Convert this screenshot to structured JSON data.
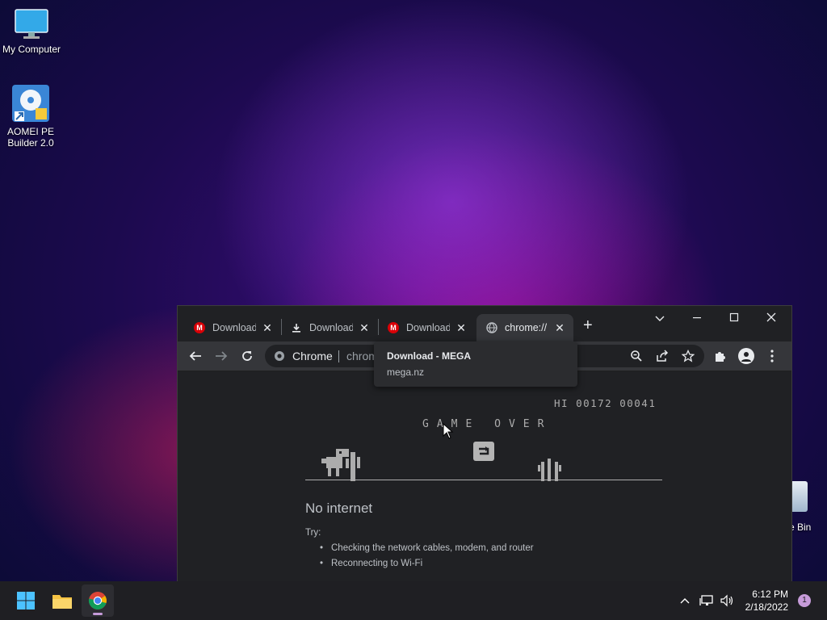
{
  "desktop": {
    "icons": [
      {
        "label": "My Computer",
        "icon": "monitor-icon"
      },
      {
        "label": "AOMEI PE\nBuilder 2.0",
        "icon": "aomei-disc-icon"
      },
      {
        "label": "e Bin",
        "icon": "recycle-bin-icon"
      }
    ]
  },
  "browser": {
    "tabs": [
      {
        "title": "Download",
        "icon": "mega-logo-icon"
      },
      {
        "title": "Download",
        "icon": "download-arrow-icon"
      },
      {
        "title": "Download",
        "icon": "mega-logo-icon"
      },
      {
        "title": "chrome://",
        "icon": "globe-icon",
        "active": true
      }
    ],
    "new_tab": "+",
    "omnibox": {
      "chip": "Chrome",
      "url": "chrome://network-error/-106"
    },
    "tooltip": {
      "title": "Download - MEGA",
      "subtitle": "mega.nz"
    }
  },
  "page": {
    "score": "HI 00172 00041",
    "game_over": "GAME OVER",
    "heading": "No internet",
    "try_label": "Try:",
    "suggestions": [
      "Checking the network cables, modem, and router",
      "Reconnecting to Wi-Fi"
    ]
  },
  "taskbar": {
    "time": "6:12 PM",
    "date": "2/18/2022",
    "notification_count": "1"
  },
  "colors": {
    "accent": "#8ab4f8",
    "mega_red": "#d90007"
  }
}
